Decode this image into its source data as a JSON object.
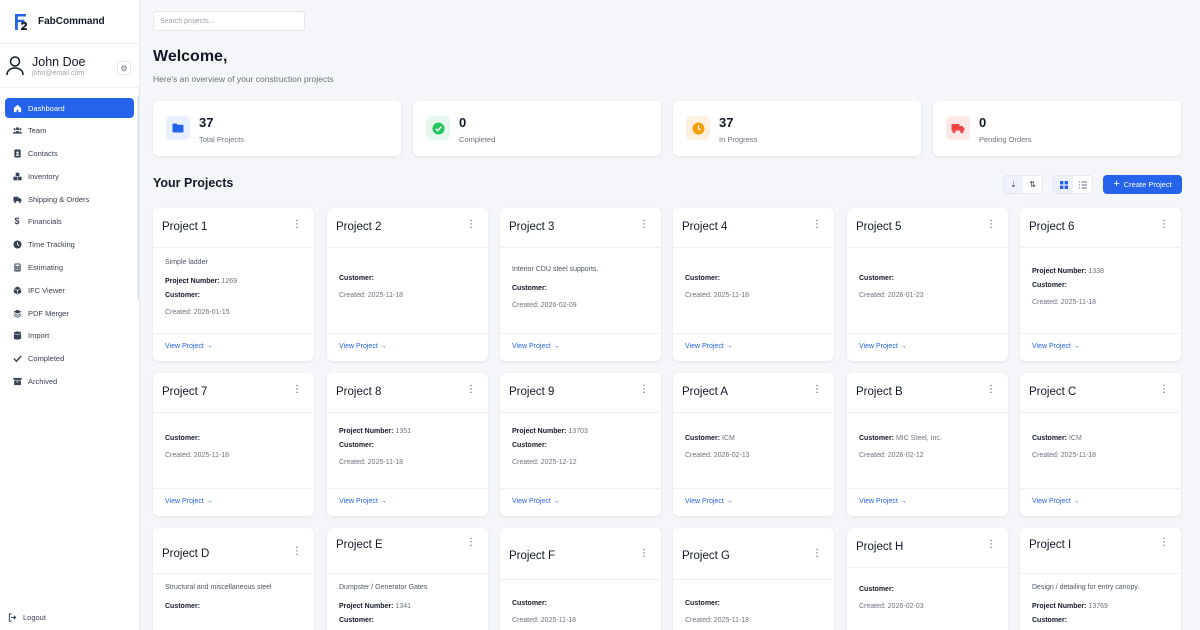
{
  "app": {
    "name": "FabCommand"
  },
  "user": {
    "name": "John Doe",
    "email": "john@email.com"
  },
  "nav": [
    {
      "label": "Dashboard",
      "icon": "home-icon",
      "active": true
    },
    {
      "label": "Team",
      "icon": "users-icon"
    },
    {
      "label": "Contacts",
      "icon": "contact-card-icon"
    },
    {
      "label": "Inventory",
      "icon": "boxes-icon"
    },
    {
      "label": "Shipping & Orders",
      "icon": "truck-icon"
    },
    {
      "label": "Financials",
      "icon": "dollar-icon"
    },
    {
      "label": "Time Tracking",
      "icon": "clock-icon"
    },
    {
      "label": "Estimating",
      "icon": "calculator-icon"
    },
    {
      "label": "IFC Viewer",
      "icon": "cube-icon"
    },
    {
      "label": "PDF Merger",
      "icon": "layers-icon"
    },
    {
      "label": "Import",
      "icon": "database-icon"
    },
    {
      "label": "Completed",
      "icon": "check-icon"
    },
    {
      "label": "Archived",
      "icon": "archive-icon"
    }
  ],
  "logout_label": "Logout",
  "search": {
    "placeholder": "Search projects..."
  },
  "header": {
    "title": "Welcome,",
    "subtitle": "Here's an overview of your construction projects"
  },
  "stats": [
    {
      "value": "37",
      "label": "Total Projects",
      "icon": "folder-icon",
      "color": "#2563eb",
      "bg": "#e8efff"
    },
    {
      "value": "0",
      "label": "Completed",
      "icon": "check-circle-icon",
      "color": "#22c55e",
      "bg": "#e6f8ee"
    },
    {
      "value": "37",
      "label": "In Progress",
      "icon": "clock-icon",
      "color": "#f59e0b",
      "bg": "#fdf0df"
    },
    {
      "value": "0",
      "label": "Pending Orders",
      "icon": "truck-icon",
      "color": "#ef4444",
      "bg": "#fde8e8"
    }
  ],
  "projects_title": "Your Projects",
  "create_label": "Create Project",
  "labels": {
    "project_number": "Project Number:",
    "customer": "Customer:",
    "view": "View Project"
  },
  "projects": [
    {
      "title": "Project 1",
      "description": "Simple ladder",
      "number": "1269",
      "customer": "",
      "created": "Created: 2026-01-15"
    },
    {
      "title": "Project 2",
      "customer": "",
      "created": "Created: 2025-11-18"
    },
    {
      "title": "Project 3",
      "description": "Interior CDU steel supports.",
      "customer": "",
      "created": "Created: 2026-02-09"
    },
    {
      "title": "Project 4",
      "customer": "",
      "created": "Created: 2025-11-18"
    },
    {
      "title": "Project 5",
      "customer": "",
      "created": "Created: 2026-01-23"
    },
    {
      "title": "Project 6",
      "number": "1338",
      "customer": "",
      "created": "Created: 2025-11-18"
    },
    {
      "title": "Project 7",
      "customer": "",
      "created": "Created: 2025-11-18"
    },
    {
      "title": "Project 8",
      "number": "1351",
      "customer": "",
      "created": "Created: 2025-11-18"
    },
    {
      "title": "Project 9",
      "number": "13703",
      "customer": "",
      "created": "Created: 2025-12-12"
    },
    {
      "title": "Project A",
      "customer": "ICM",
      "created": "Created: 2026-02-13"
    },
    {
      "title": "Project B",
      "customer": "MIC Steel, Inc.",
      "created": "Created: 2026-02-12"
    },
    {
      "title": "Project C",
      "customer": "ICM",
      "created": "Created: 2025-11-18"
    },
    {
      "title": "Project D",
      "description": "Structural and miscellaneous steel",
      "customer": ""
    },
    {
      "title": "Project E",
      "description": "Dumpster / Generator Gates",
      "number": "1341",
      "customer": "",
      "created": "Created: 2025-11-18"
    },
    {
      "title": "Project F",
      "customer": "",
      "created": "Created: 2025-11-18"
    },
    {
      "title": "Project G",
      "customer": "",
      "created": "Created: 2025-11-18"
    },
    {
      "title": "Project H",
      "customer": "",
      "created": "Created: 2026-02-03"
    },
    {
      "title": "Project I",
      "description": "Design / detailing for entry canopy.",
      "number": "13769",
      "customer": ""
    }
  ]
}
